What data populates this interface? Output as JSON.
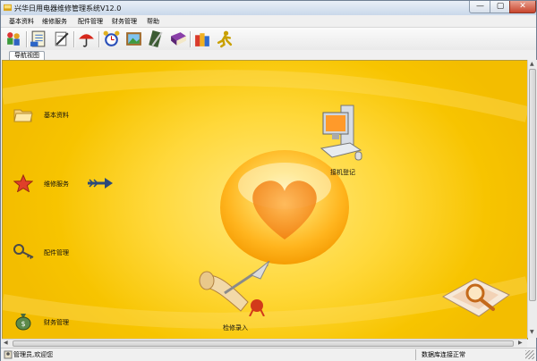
{
  "window": {
    "title": "兴华日用电器维修管理系统V12.0",
    "minimize_glyph": "—",
    "maximize_glyph": "▢",
    "close_glyph": "✕"
  },
  "menu": [
    {
      "label": "基本资料"
    },
    {
      "label": "维修服务"
    },
    {
      "label": "配件管理"
    },
    {
      "label": "财务管理"
    },
    {
      "label": "帮助"
    }
  ],
  "toolbar": {
    "icons": [
      "users-icon",
      "notebook-icon",
      "write-icon",
      "umbrella-icon",
      "alarm-clock-icon",
      "picture-frame-icon",
      "pen-book-icon",
      "purple-book-icon",
      "gift-boxes-icon",
      "runner-icon"
    ]
  },
  "tab": {
    "label": "导航视图"
  },
  "nav": {
    "basic": "基本资料",
    "service": "维修服务",
    "parts": "配件管理",
    "finance": "财务管理",
    "register": "接机登记",
    "repair_entry": "检修录入"
  },
  "status": {
    "user": "管理员,欢迎您",
    "connection": "数据库连接正常"
  },
  "colors": {
    "background_yellow": "#f7c400",
    "heart_orange": "#ff9a1a",
    "title_blue": "#c9d8ea"
  }
}
